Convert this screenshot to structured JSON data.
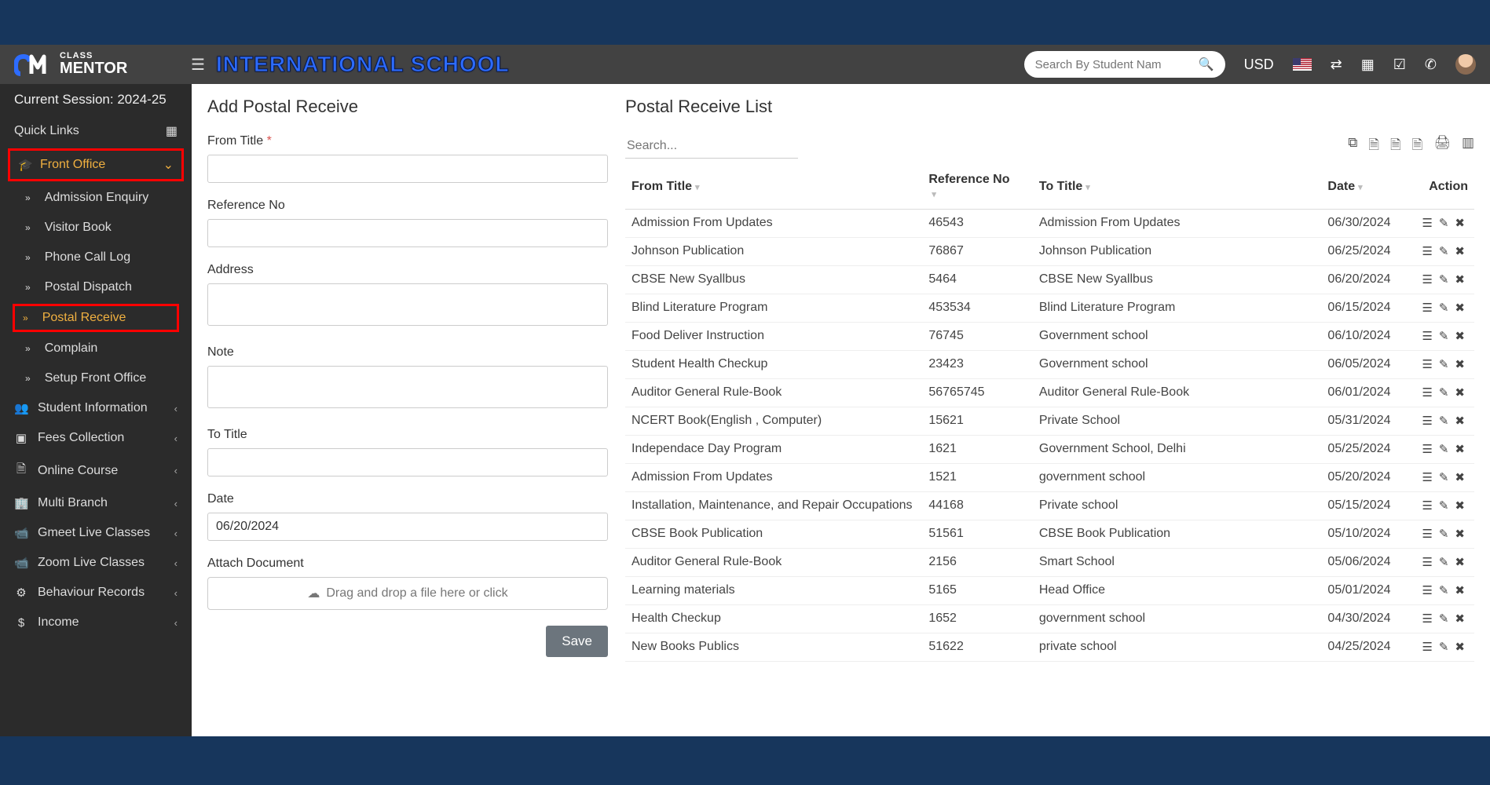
{
  "header": {
    "school_name": "INTERNATIONAL SCHOOL",
    "search_placeholder": "Search By Student Nam",
    "currency": "USD"
  },
  "logo": {
    "line1": "CLASS",
    "line2": "MENTOR"
  },
  "sidebar": {
    "session": "Current Session: 2024-25",
    "quick_links": "Quick Links",
    "front_office": "Front Office",
    "front_office_items": [
      "Admission Enquiry",
      "Visitor Book",
      "Phone Call Log",
      "Postal Dispatch",
      "Postal Receive",
      "Complain",
      "Setup Front Office"
    ],
    "other_items": [
      "Student Information",
      "Fees Collection",
      "Online Course",
      "Multi Branch",
      "Gmeet Live Classes",
      "Zoom Live Classes",
      "Behaviour Records",
      "Income"
    ]
  },
  "form": {
    "title": "Add Postal Receive",
    "labels": {
      "from_title": "From Title",
      "reference_no": "Reference No",
      "address": "Address",
      "note": "Note",
      "to_title": "To Title",
      "date": "Date",
      "attach": "Attach Document"
    },
    "date_value": "06/20/2024",
    "dropzone": "Drag and drop a file here or click",
    "save": "Save"
  },
  "list": {
    "title": "Postal Receive List",
    "search_placeholder": "Search...",
    "columns": {
      "from": "From Title",
      "ref": "Reference No",
      "to": "To Title",
      "date": "Date",
      "action": "Action"
    },
    "rows": [
      {
        "from": "Admission From Updates",
        "ref": "46543",
        "to": "Admission From Updates",
        "date": "06/30/2024"
      },
      {
        "from": "Johnson Publication",
        "ref": "76867",
        "to": "Johnson Publication",
        "date": "06/25/2024"
      },
      {
        "from": "CBSE New Syallbus",
        "ref": "5464",
        "to": "CBSE New Syallbus",
        "date": "06/20/2024"
      },
      {
        "from": "Blind Literature Program",
        "ref": "453534",
        "to": "Blind Literature Program",
        "date": "06/15/2024"
      },
      {
        "from": "Food Deliver Instruction",
        "ref": "76745",
        "to": "Government school",
        "date": "06/10/2024"
      },
      {
        "from": "Student Health Checkup",
        "ref": "23423",
        "to": "Government school",
        "date": "06/05/2024"
      },
      {
        "from": "Auditor General Rule-Book",
        "ref": "56765745",
        "to": "Auditor General Rule-Book",
        "date": "06/01/2024"
      },
      {
        "from": "NCERT Book(English , Computer)",
        "ref": "15621",
        "to": "Private School",
        "date": "05/31/2024"
      },
      {
        "from": "Independace Day Program",
        "ref": "1621",
        "to": "Government School, Delhi",
        "date": "05/25/2024"
      },
      {
        "from": "Admission From Updates",
        "ref": "1521",
        "to": "government school",
        "date": "05/20/2024"
      },
      {
        "from": "Installation, Maintenance, and Repair Occupations",
        "ref": "44168",
        "to": "Private school",
        "date": "05/15/2024"
      },
      {
        "from": "CBSE Book Publication",
        "ref": "51561",
        "to": "CBSE Book Publication",
        "date": "05/10/2024"
      },
      {
        "from": "Auditor General Rule-Book",
        "ref": "2156",
        "to": "Smart School",
        "date": "05/06/2024"
      },
      {
        "from": "Learning materials",
        "ref": "5165",
        "to": "Head Office",
        "date": "05/01/2024"
      },
      {
        "from": "Health Checkup",
        "ref": "1652",
        "to": "government school",
        "date": "04/30/2024"
      },
      {
        "from": "New Books Publics",
        "ref": "51622",
        "to": "private school",
        "date": "04/25/2024"
      }
    ]
  }
}
